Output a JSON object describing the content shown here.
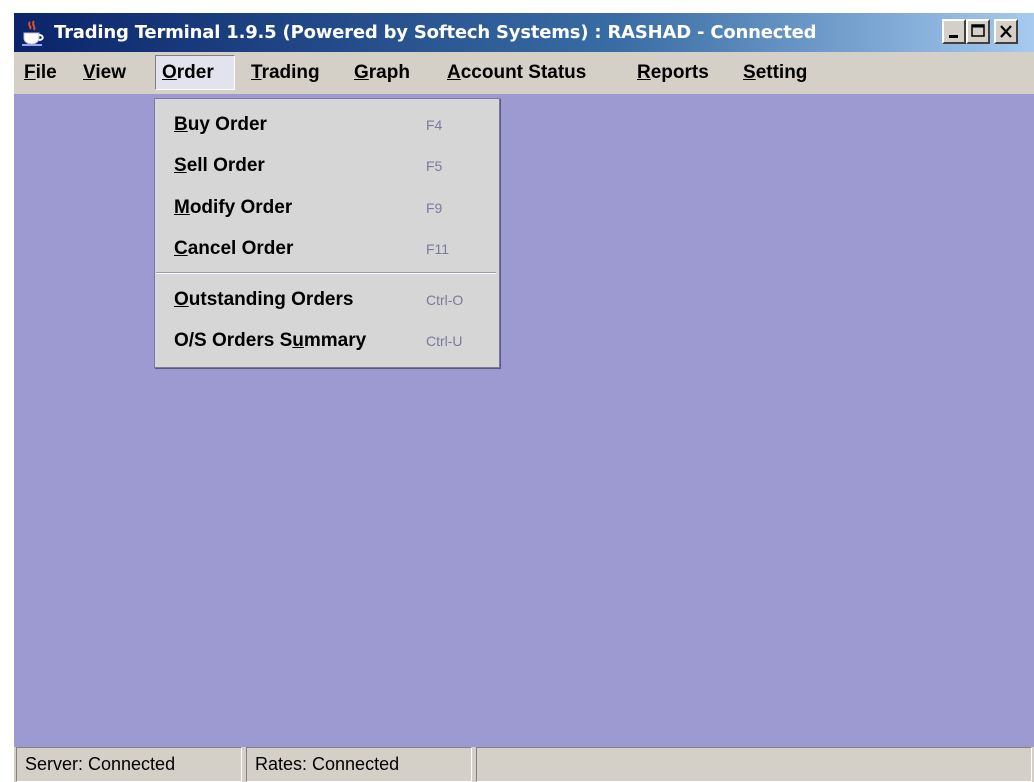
{
  "window": {
    "title": "Trading Terminal 1.9.5 (Powered by Softech Systems)  :  RASHAD - Connected",
    "controls": {
      "minimize": "minimize",
      "maximize": "maximize",
      "close": "close"
    }
  },
  "menubar": {
    "items": [
      {
        "label": "File",
        "mnemonic": "F",
        "rest": "ile"
      },
      {
        "label": "View",
        "mnemonic": "V",
        "rest": "iew"
      },
      {
        "label": "Order",
        "mnemonic": "O",
        "rest": "rder",
        "active": true
      },
      {
        "label": "Trading",
        "mnemonic": "T",
        "rest": "rading"
      },
      {
        "label": "Graph",
        "mnemonic": "G",
        "rest": "raph"
      },
      {
        "label": "Account Status",
        "mnemonic": "A",
        "rest": "ccount Status"
      },
      {
        "label": "Reports",
        "mnemonic": "R",
        "rest": "eports"
      },
      {
        "label": "Setting",
        "mnemonic": "S",
        "rest": "etting"
      }
    ]
  },
  "order_menu": {
    "items": [
      {
        "pre": "",
        "mnemonic": "B",
        "post": "uy Order",
        "shortcut": "F4"
      },
      {
        "pre": "",
        "mnemonic": "S",
        "post": "ell Order",
        "shortcut": "F5"
      },
      {
        "pre": "",
        "mnemonic": "M",
        "post": "odify Order",
        "shortcut": "F9"
      },
      {
        "pre": "",
        "mnemonic": "C",
        "post": "ancel Order",
        "shortcut": "F11"
      },
      {
        "pre": "",
        "mnemonic": "O",
        "post": "utstanding Orders",
        "shortcut": "Ctrl-O"
      },
      {
        "pre": "O/S Orders S",
        "mnemonic": "u",
        "post": "mmary",
        "shortcut": "Ctrl-U"
      }
    ]
  },
  "statusbar": {
    "server": "Server: Connected",
    "rates": "Rates: Connected",
    "message": ""
  },
  "colors": {
    "desktop": "#9c9ad0",
    "menu_bg": "#d6d6d6",
    "titlebar_start": "#0a246a",
    "titlebar_end": "#a6caf0",
    "shortcut_text": "#7a7a9c"
  },
  "icons": {
    "app": "java-cup-icon"
  }
}
